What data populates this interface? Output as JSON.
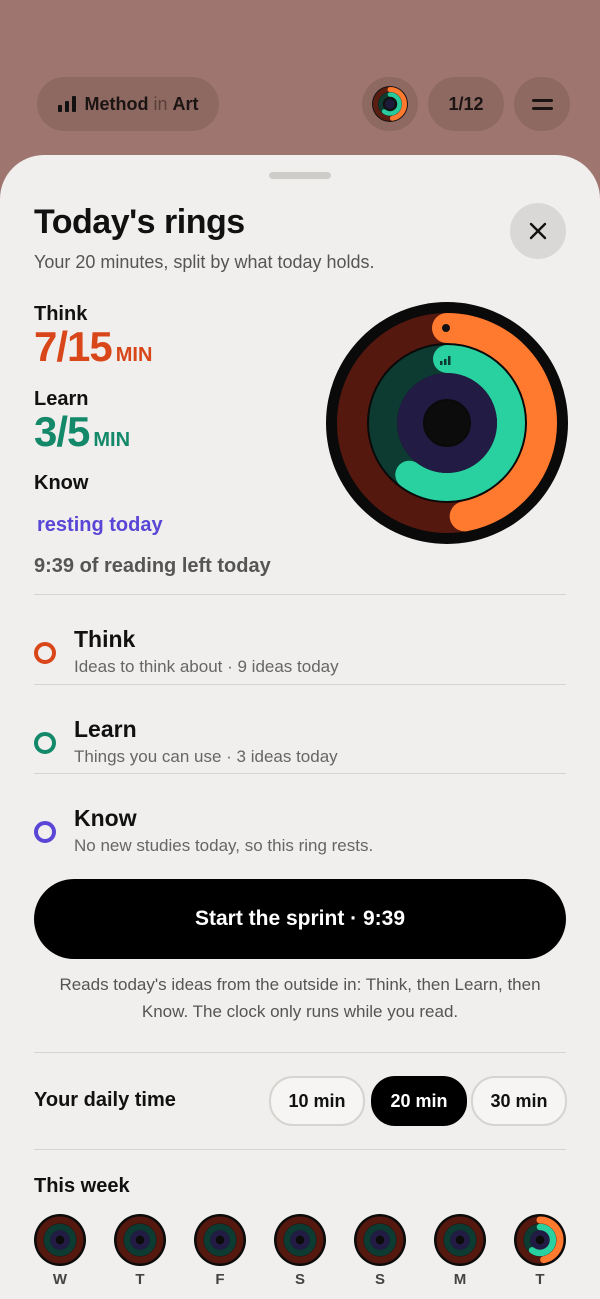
{
  "colors": {
    "think": "#ff7a2f",
    "learn": "#28c99a",
    "know": "#5a46d6",
    "background": "#9e766f"
  },
  "topbar": {
    "brand_method": "Method",
    "brand_in": "in",
    "brand_art": "Art",
    "page_indicator": "1/12",
    "brand_icon": "bar-chart-icon",
    "menu_icon": "menu-icon"
  },
  "sheet": {
    "title": "Today's rings",
    "subtitle": "Your 20 minutes, split by what today holds.",
    "close_icon": "close-icon"
  },
  "stats": {
    "think_label": "Think",
    "think_value": "7/15",
    "think_unit": "MIN",
    "learn_label": "Learn",
    "learn_value": "3/5",
    "learn_unit": "MIN",
    "know_label": "Know",
    "know_status": "resting today",
    "time_left": "9:39 of reading left today"
  },
  "rings": {
    "think_progress": 0.47,
    "learn_progress": 0.6,
    "know_progress": 0
  },
  "ring_list": [
    {
      "name": "Think",
      "desc": "Ideas to think about · 9 ideas today"
    },
    {
      "name": "Learn",
      "desc": "Things you can use · 3 ideas today"
    },
    {
      "name": "Know",
      "desc": "No new studies today, so this ring rests."
    }
  ],
  "sprint": {
    "button_label": "Start the sprint · 9:39",
    "note": "Reads today's ideas from the outside in: Think, then Learn, then Know. The clock only runs while you read."
  },
  "daily_time": {
    "label": "Your daily time",
    "options": [
      "10 min",
      "20 min",
      "30 min"
    ],
    "selected": "20 min"
  },
  "week": {
    "title": "This week",
    "days": [
      "W",
      "T",
      "F",
      "S",
      "S",
      "M",
      "T"
    ]
  }
}
